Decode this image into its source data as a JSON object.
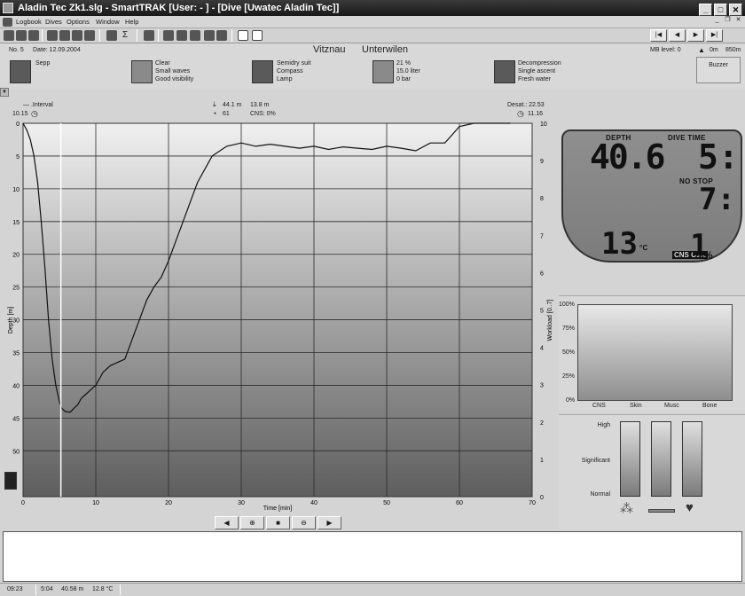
{
  "titlebar": {
    "title": "Aladin Tec Zk1.slg - SmartTRAK  [User:  - ] - [Dive  [Uwatec Aladin Tec]]"
  },
  "menu": {
    "items": [
      "Logbook",
      "Dives",
      "Options",
      "Window",
      "Help"
    ]
  },
  "info": {
    "dive_no": "No. 5",
    "date": "Date: 12.09.2004",
    "location": "Vitznau",
    "site": "Unterwilen",
    "mb_level": "MB level: 0",
    "altitude": "0m",
    "altitude_max": "850m",
    "buddy": "Sepp",
    "weather": [
      "Clear",
      "Small waves",
      "Good visibility"
    ],
    "equipment": [
      "Semidry suit",
      "Compass",
      "Lamp"
    ],
    "gas": [
      "21 %",
      "15.0 liter",
      "0 bar"
    ],
    "dive_type": [
      "Decompression",
      "Single ascent",
      "Fresh water"
    ],
    "buzzer": "Buzzer"
  },
  "graph_header": {
    "interval_label": "Interval",
    "interval_value": "10.15",
    "max_depth": "44.1 m",
    "avg_depth": "13.8 m",
    "cns_pct": "61",
    "cns_label": "CNS:  0%",
    "desat_label": "Desat.: 22.53",
    "desat_value": "11.16"
  },
  "chart_data": {
    "type": "line",
    "xlabel": "Time [min]",
    "ylabel": "Depth [m]",
    "y2label": "Workload [0..7]",
    "xlim": [
      0,
      70
    ],
    "ylim": [
      0,
      57
    ],
    "y2lim": [
      0,
      10
    ],
    "x_ticks": [
      0,
      10,
      20,
      30,
      40,
      50,
      60,
      70
    ],
    "y_ticks": [
      0,
      5,
      10,
      15,
      20,
      25,
      30,
      35,
      40,
      45,
      50
    ],
    "y2_ticks": [
      10,
      9,
      8,
      7,
      6,
      5,
      4,
      3,
      2,
      1,
      0
    ],
    "grid": true,
    "cursor_x": 5.2,
    "series": [
      {
        "x": [
          0,
          0.5,
          1,
          1.5,
          2,
          2.5,
          3,
          3.5,
          4,
          4.5,
          5,
          5.3,
          5.8,
          6.5,
          7,
          7.5,
          8,
          8.5,
          9,
          9.5,
          10,
          11,
          12,
          13,
          14,
          15,
          16,
          17,
          18,
          19,
          20,
          21,
          22,
          23,
          24,
          25,
          26,
          28,
          30,
          32,
          34,
          36,
          38,
          40,
          42,
          44,
          46,
          48,
          50,
          52,
          54,
          56,
          57,
          58,
          60,
          62,
          64,
          66,
          67
        ],
        "y": [
          0,
          1,
          2.5,
          5,
          9,
          15,
          22,
          30,
          36,
          40,
          42.5,
          43.5,
          44,
          44.1,
          43.5,
          43,
          42,
          41.5,
          41,
          40.5,
          40,
          38,
          37,
          36.5,
          36,
          33,
          30,
          27,
          25,
          23.5,
          21,
          18,
          15,
          12,
          9,
          7,
          5,
          3.5,
          3,
          3.5,
          3.2,
          3.5,
          3.8,
          3.5,
          4,
          3.6,
          3.8,
          4,
          3.5,
          3.8,
          4.2,
          3,
          3,
          3,
          0.5,
          0,
          0,
          0,
          0
        ]
      }
    ]
  },
  "computer": {
    "depth_label": "DEPTH",
    "dive_time_label": "DIVE TIME",
    "depth": "40.6",
    "dive_time": "5:",
    "no_stop_label": "NO STOP",
    "no_stop": "7:",
    "temp": "13",
    "temp_unit": "°C",
    "cns_label": "CNS O₂%",
    "cns": "1",
    "cns_unit": "%"
  },
  "saturation": {
    "y_labels": [
      "100%",
      "75%",
      "50%",
      "25%",
      "0%"
    ],
    "categories": [
      "CNS",
      "Skin",
      "Musc",
      "Bone"
    ]
  },
  "workload": {
    "labels": [
      "High",
      "Significant",
      "Normal"
    ]
  },
  "status": {
    "time": "09:23",
    "elapsed": "5:04",
    "depth": "40.58 m",
    "temp": "12.8 °C"
  },
  "controls": [
    "◀",
    "⊕",
    "■",
    "⊖",
    "▶"
  ]
}
